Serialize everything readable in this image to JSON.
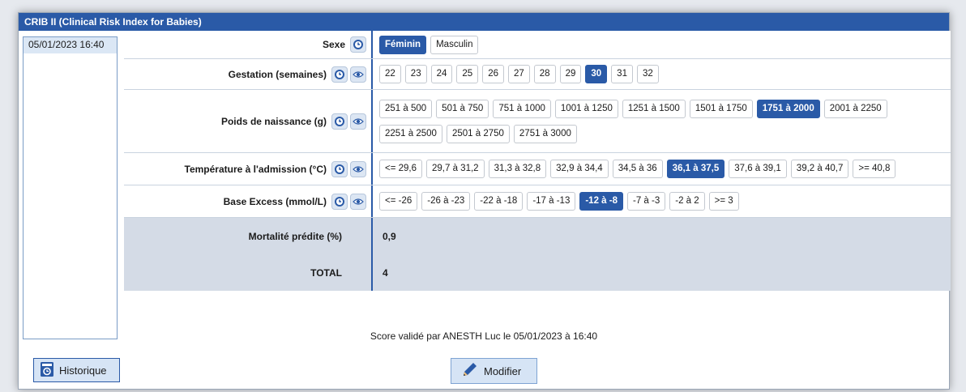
{
  "window": {
    "title": "CRIB II (Clinical Risk Index for Babies)"
  },
  "history": {
    "items": [
      "05/01/2023 16:40"
    ]
  },
  "criteria": [
    {
      "label": "Sexe",
      "has_eye": false,
      "options": [
        "Féminin",
        "Masculin"
      ],
      "selected": "Féminin"
    },
    {
      "label": "Gestation (semaines)",
      "has_eye": true,
      "options": [
        "22",
        "23",
        "24",
        "25",
        "26",
        "27",
        "28",
        "29",
        "30",
        "31",
        "32"
      ],
      "selected": "30"
    },
    {
      "label": "Poids de naissance (g)",
      "has_eye": true,
      "options": [
        "251 à 500",
        "501 à 750",
        "751 à 1000",
        "1001 à 1250",
        "1251 à 1500",
        "1501 à 1750",
        "1751 à 2000",
        "2001 à 2250",
        "2251 à 2500",
        "2501 à 2750",
        "2751 à 3000"
      ],
      "selected": "1751 à 2000"
    },
    {
      "label": "Température à l'admission (°C)",
      "has_eye": true,
      "options": [
        "<= 29,6",
        "29,7 à 31,2",
        "31,3 à 32,8",
        "32,9 à 34,4",
        "34,5 à 36",
        "36,1 à 37,5",
        "37,6 à 39,1",
        "39,2 à 40,7",
        ">= 40,8"
      ],
      "selected": "36,1 à 37,5"
    },
    {
      "label": "Base Excess (mmol/L)",
      "has_eye": true,
      "options": [
        "<= -26",
        "-26 à -23",
        "-22 à -18",
        "-17 à -13",
        "-12 à -8",
        "-7 à -3",
        "-2 à 2",
        ">= 3"
      ],
      "selected": "-12 à -8"
    }
  ],
  "results": {
    "mortality_label": "Mortalité prédite (%)",
    "mortality_value": "0,9",
    "total_label": "TOTAL",
    "total_value": "4"
  },
  "validation_text": "Score validé par ANESTH Luc le 05/01/2023 à 16:40",
  "buttons": {
    "historique_label": "Historique",
    "modifier_label": "Modifier"
  },
  "colors": {
    "accent": "#2a5aa7",
    "result_bg": "#d4dbe6",
    "list_selection": "#dbe7f5"
  }
}
